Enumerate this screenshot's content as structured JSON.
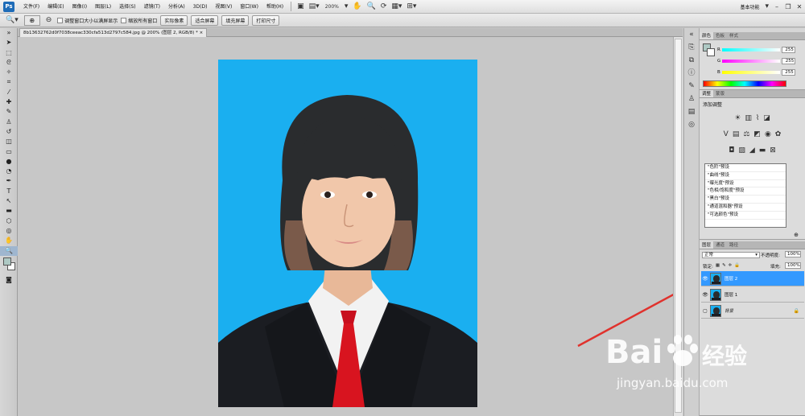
{
  "app": {
    "logo": "Ps"
  },
  "menu": [
    "文件(F)",
    "编辑(E)",
    "图像(I)",
    "图层(L)",
    "选择(S)",
    "滤镜(T)",
    "分析(A)",
    "3D(D)",
    "视图(V)",
    "窗口(W)",
    "帮助(H)"
  ],
  "toolbar": {
    "zoom": "200%",
    "workspace": "基本功能"
  },
  "options": {
    "checkbox1": "调整窗口大小以满屏显示",
    "checkbox2": "缩放所有窗口",
    "btn_actual": "实际像素",
    "btn_fit": "适合屏幕",
    "btn_fill": "填充屏幕",
    "btn_print": "打印尺寸"
  },
  "document": {
    "tab_title": "8b13632762d0f7038ceeac330cfa513d2797c584.jpg @ 200% (图层 2, RGB/8) *"
  },
  "color_panel": {
    "tabs": [
      "颜色",
      "色板",
      "样式"
    ],
    "r_label": "R",
    "g_label": "G",
    "b_label": "B",
    "r_value": "255",
    "g_value": "255",
    "b_value": "255"
  },
  "adjust_panel": {
    "tabs": [
      "调整",
      "蒙版"
    ],
    "title": "添加调整",
    "presets": [
      "\"色阶\"预设",
      "\"曲线\"预设",
      "\"曝光度\"预设",
      "\"色相/饱和度\"预设",
      "\"黑白\"预设",
      "\"通道混和器\"预设",
      "\"可选颜色\"预设"
    ]
  },
  "layers_panel": {
    "tabs": [
      "图层",
      "通道",
      "路径"
    ],
    "blend_mode": "正常",
    "opacity_label": "不透明度:",
    "opacity_value": "100%",
    "lock_label": "锁定:",
    "fill_label": "填充:",
    "fill_value": "100%",
    "layers": [
      "图层 2",
      "图层 1",
      "背景"
    ]
  },
  "watermark": {
    "brand": "Bai",
    "paw": "经验",
    "url": "jingyan.baidu.com"
  },
  "colors": {
    "photo_bg": "#1aaff0",
    "selection": "#3399ff",
    "arrow": "#e0322d"
  }
}
